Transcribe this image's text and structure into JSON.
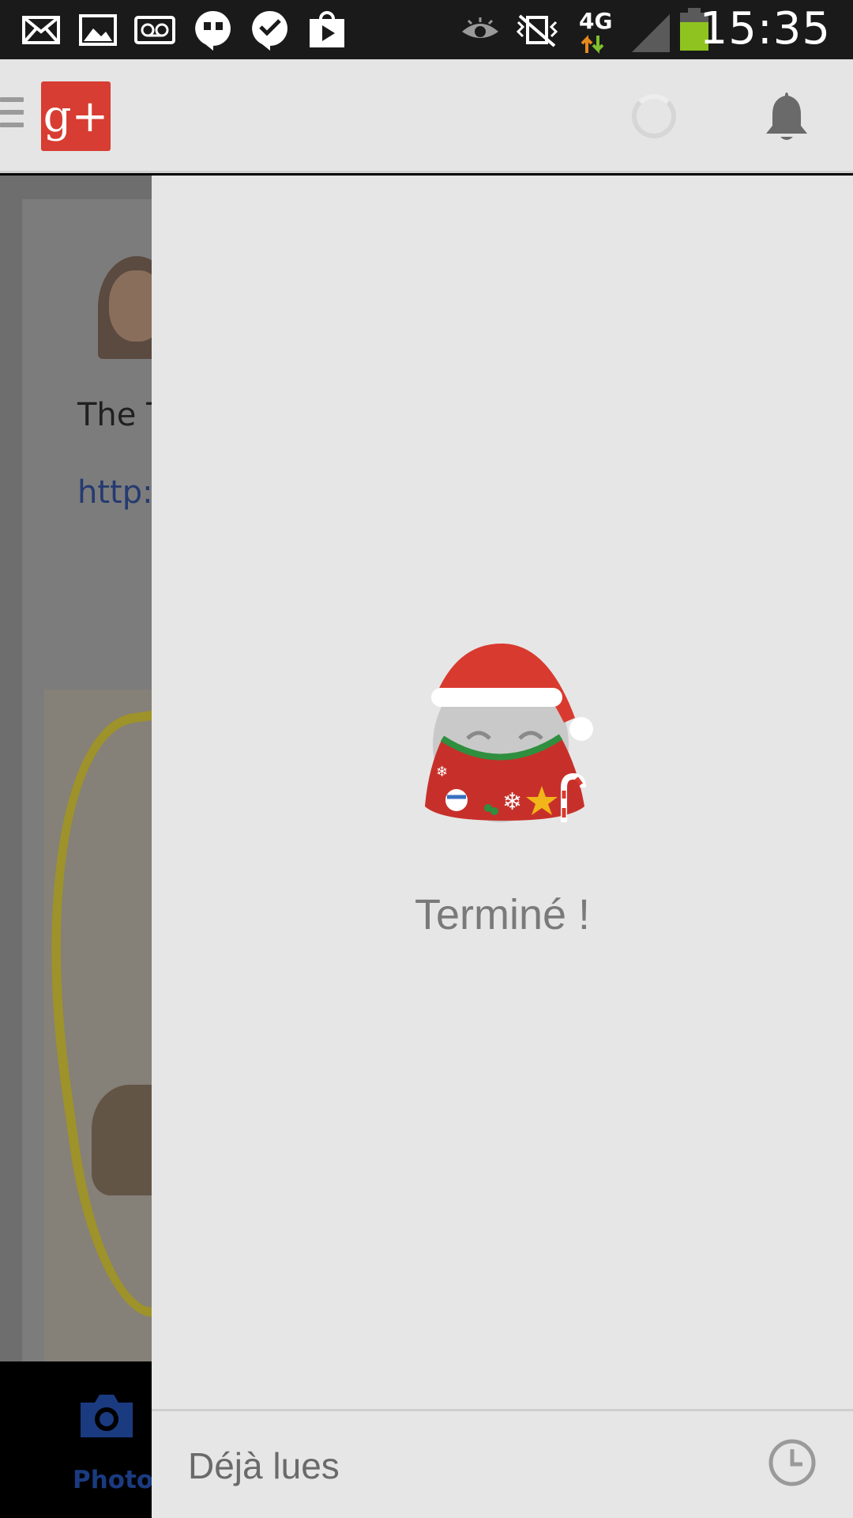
{
  "status_bar": {
    "time": "15:35",
    "network": "4G",
    "icons": [
      "mail-icon",
      "image-icon",
      "voicemail-icon",
      "hangouts-icon",
      "check-bubble-icon",
      "play-store-icon",
      "eye-icon",
      "vibrate-icon",
      "network-4g-icon",
      "signal-icon",
      "battery-icon"
    ]
  },
  "action_bar": {
    "logo_text": "g+",
    "icons": [
      "menu-icon",
      "loading-spinner",
      "bell-icon"
    ]
  },
  "stream": {
    "post_text": "The Tr",
    "post_link": "http://",
    "bottom_action": "Photo"
  },
  "notifications": {
    "empty_message": "Terminé !",
    "footer_label": "Déjà lues",
    "footer_icon": "clock-icon"
  },
  "colors": {
    "gplus_red": "#d73d32",
    "drawer_bg": "#e6e6e6",
    "photo_blue": "#1b3b80"
  }
}
